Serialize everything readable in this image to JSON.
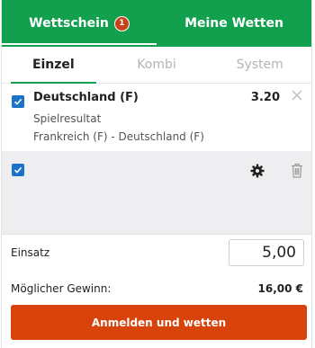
{
  "top_tabs": {
    "betslip_label": "Wettschein",
    "betslip_count": "1",
    "mybets_label": "Meine Wetten"
  },
  "sub_tabs": [
    "Einzel",
    "Kombi",
    "System"
  ],
  "bet": {
    "checked": true,
    "title": "Deutschland (F)",
    "market": "Spielresultat",
    "event": "Frankreich (F) - Deutschland (F)",
    "odds": "3.20",
    "remove_icon": "close-icon"
  },
  "toolbar": {
    "select_all_checked": true,
    "settings_icon": "gear-icon",
    "delete_icon": "trash-icon"
  },
  "stake": {
    "label": "Einsatz",
    "value": "5,00"
  },
  "potential_win": {
    "label": "Möglicher Gewinn:",
    "value": "16,00 €"
  },
  "submit_label": "Anmelden und wetten",
  "colors": {
    "brand_green": "#13a04e",
    "badge_red": "#c8411b",
    "checkbox_blue": "#1a73c9",
    "submit_orange": "#d8430b",
    "grey_area": "#eeeef1"
  }
}
